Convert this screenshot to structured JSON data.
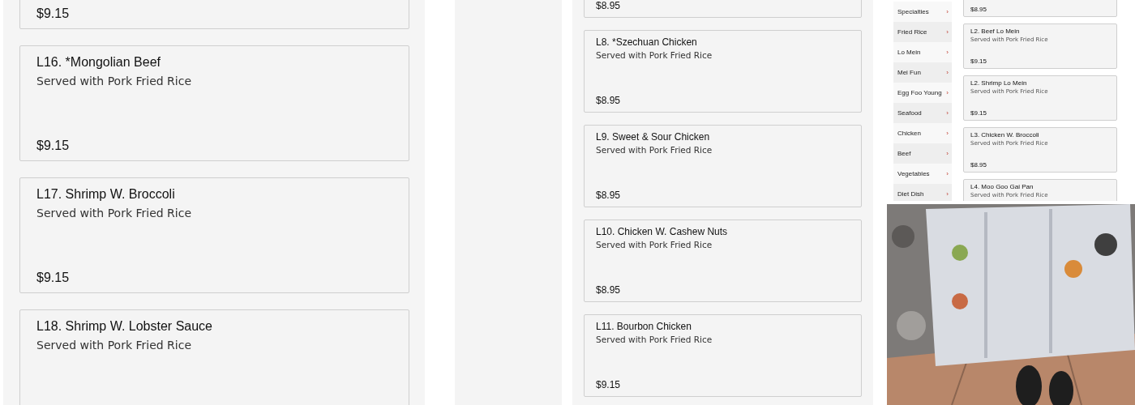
{
  "left_screenshot": {
    "items": [
      {
        "price": "$9.15"
      },
      {
        "title": "L16. *Mongolian Beef",
        "description": "Served with Pork Fried Rice",
        "price": "$9.15"
      },
      {
        "title": "L17. Shrimp W. Broccoli",
        "description": "Served with Pork Fried Rice",
        "price": "$9.15"
      },
      {
        "title": "L18. Shrimp W. Lobster Sauce",
        "description": "Served with Pork Fried Rice"
      }
    ]
  },
  "middle_screenshot": {
    "items": [
      {
        "price": "$8.95"
      },
      {
        "title": "L8. *Szechuan Chicken",
        "description": "Served with Pork Fried Rice",
        "price": "$8.95"
      },
      {
        "title": "L9. Sweet & Sour Chicken",
        "description": "Served with Pork Fried Rice",
        "price": "$8.95"
      },
      {
        "title": "L10. Chicken W. Cashew Nuts",
        "description": "Served with Pork Fried Rice",
        "price": "$8.95"
      },
      {
        "title": "L11. Bourbon Chicken",
        "description": "Served with Pork Fried Rice",
        "price": "$9.15"
      }
    ]
  },
  "right_screenshot": {
    "categories": [
      "Specialties",
      "Fried Rice",
      "Lo Mein",
      "Mei Fun",
      "Egg Foo Young",
      "Seafood",
      "Chicken",
      "Beef",
      "Vegetables",
      "Diet Dish"
    ],
    "chevron": "›",
    "items": [
      {
        "price": "$8.95"
      },
      {
        "title": "L2. Beef Lo Mein",
        "description": "Served with Pork Fried Rice",
        "price": "$9.15"
      },
      {
        "title": "L2. Shrimp Lo Mein",
        "description": "Served with Pork Fried Rice",
        "price": "$9.15"
      },
      {
        "title": "L3. Chicken W. Broccoli",
        "description": "Served with Pork Fried Rice",
        "price": "$8.95"
      },
      {
        "title": "L4. Moo Goo Gai Pan",
        "description": "Served with Pork Fried Rice"
      }
    ]
  }
}
